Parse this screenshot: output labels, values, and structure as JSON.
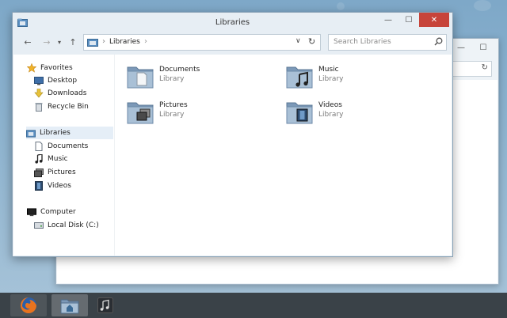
{
  "window": {
    "title": "Libraries"
  },
  "titlebar": {
    "minimize_glyph": "—",
    "maximize_glyph": "☐",
    "close_glyph": "✕"
  },
  "navbar": {
    "back_glyph": "←",
    "forward_glyph": "→",
    "recent_glyph": "▾",
    "up_glyph": "↑",
    "breadcrumb": "Libraries",
    "dropdown_glyph": "∨",
    "refresh_glyph": "↻",
    "search_placeholder": "Search Libraries"
  },
  "sidebar": {
    "favorites": {
      "label": "Favorites",
      "icon": "star-icon"
    },
    "favorite_items": [
      {
        "label": "Desktop",
        "icon": "desktop-icon"
      },
      {
        "label": "Downloads",
        "icon": "download-arrow-icon"
      },
      {
        "label": "Recycle Bin",
        "icon": "recycle-bin-icon"
      }
    ],
    "libraries": {
      "label": "Libraries",
      "icon": "libraries-icon"
    },
    "library_items": [
      {
        "label": "Documents",
        "icon": "document-icon"
      },
      {
        "label": "Music",
        "icon": "music-note-icon"
      },
      {
        "label": "Pictures",
        "icon": "pictures-icon"
      },
      {
        "label": "Videos",
        "icon": "film-icon"
      }
    ],
    "computer": {
      "label": "Computer",
      "icon": "monitor-icon"
    },
    "computer_items": [
      {
        "label": "Local Disk (C:)",
        "icon": "disk-icon"
      }
    ]
  },
  "libraries": [
    {
      "name": "Documents",
      "type": "Library",
      "icon": "documents-library-icon"
    },
    {
      "name": "Music",
      "type": "Library",
      "icon": "music-library-icon"
    },
    {
      "name": "Pictures",
      "type": "Library",
      "icon": "pictures-library-icon"
    },
    {
      "name": "Videos",
      "type": "Library",
      "icon": "videos-library-icon"
    }
  ],
  "taskbar": {
    "items": [
      {
        "icon": "firefox-icon"
      },
      {
        "icon": "file-explorer-icon"
      },
      {
        "icon": "music-player-icon"
      }
    ]
  },
  "colors": {
    "close_button": "#c7443a",
    "selection": "#e5eef7",
    "taskbar": "#3a4248",
    "desktop": "#8fb4cf"
  }
}
